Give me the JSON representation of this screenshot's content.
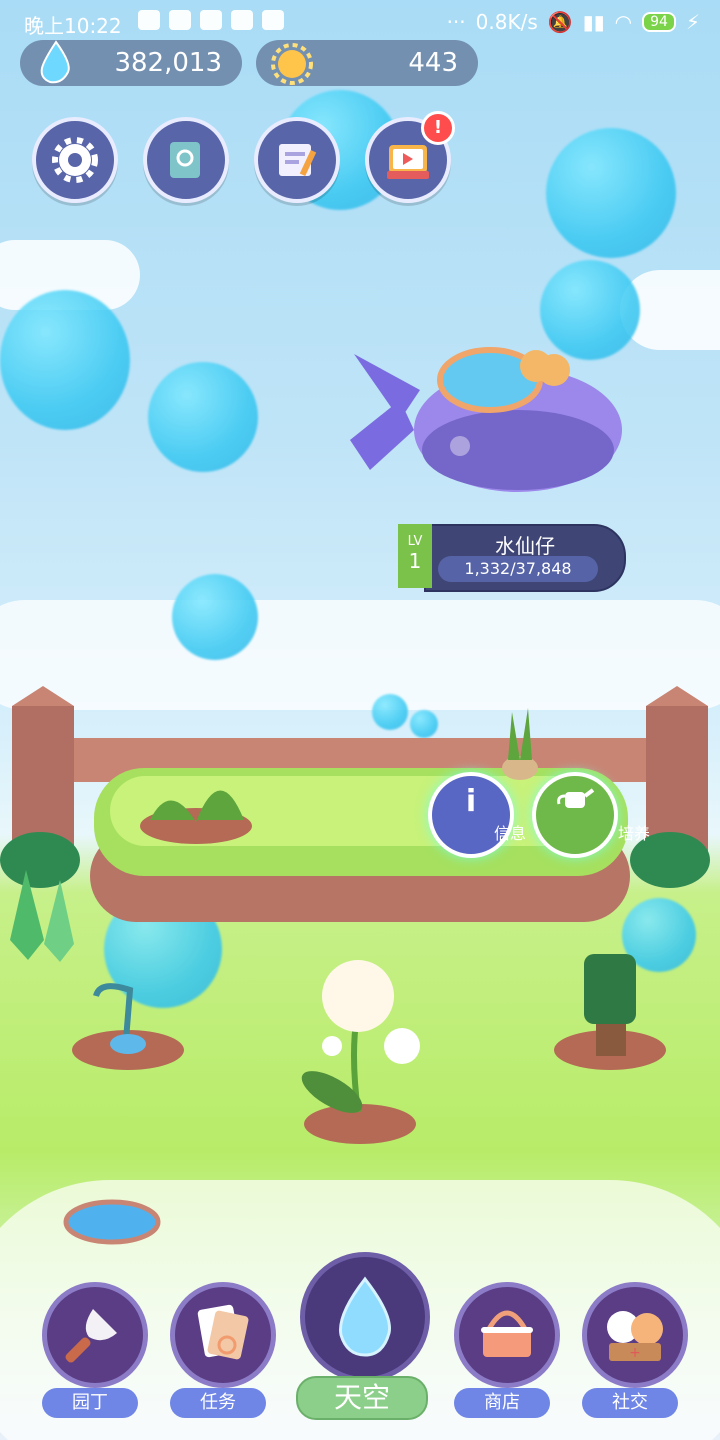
{
  "status_bar": {
    "time": "晚上10:22",
    "network_speed": "0.8K/s",
    "battery": "94"
  },
  "resources": {
    "water": "382,013",
    "sun": "443"
  },
  "top_buttons": [
    "settings-icon",
    "encyclopedia-icon",
    "journal-icon",
    "tv-ad-icon"
  ],
  "plant_info": {
    "level_label": "LV",
    "level": "1",
    "name": "水仙仔",
    "progress_text": "1,332/37,848",
    "progress": 0.035
  },
  "actions": {
    "info": "信息",
    "cultivate": "培养"
  },
  "nav": {
    "gardener": "园丁",
    "tasks": "任务",
    "sky": "天空",
    "shop": "商店",
    "social": "社交"
  },
  "colors": {
    "nav_label": "#6f86e6",
    "active_nav": "#8ccf8a",
    "grass": "#b8ec68"
  }
}
